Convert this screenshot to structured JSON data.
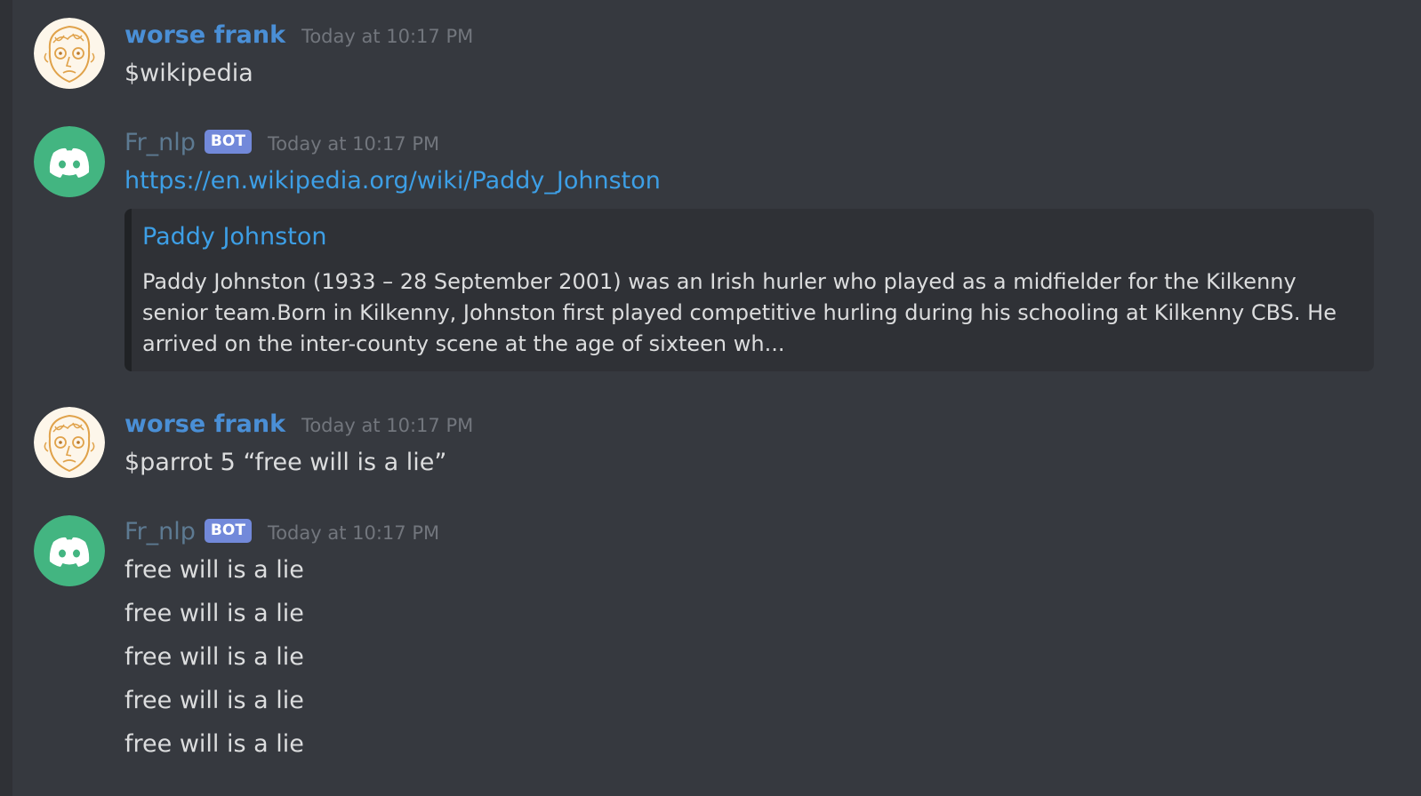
{
  "messages": [
    {
      "username": "worse frank",
      "timestamp": "Today at 10:17 PM",
      "text": "$wikipedia",
      "avatar_icon": "sketch-face-avatar-icon"
    },
    {
      "username": "Fr_nlp",
      "bot_tag": "BOT",
      "timestamp": "Today at 10:17 PM",
      "link": "https://en.wikipedia.org/wiki/Paddy_Johnston",
      "avatar_icon": "discord-logo-avatar-icon",
      "embed": {
        "title": "Paddy Johnston",
        "description": "Paddy Johnston (1933 – 28 September 2001) was an Irish hurler who played as a midfielder for the Kilkenny senior team.Born in Kilkenny, Johnston first played competitive hurling during his schooling at Kilkenny CBS. He arrived on the inter-county scene at the age of sixteen wh..."
      }
    },
    {
      "username": "worse frank",
      "timestamp": "Today at 10:17 PM",
      "text": "$parrot 5 “free will is a lie”",
      "avatar_icon": "sketch-face-avatar-icon"
    },
    {
      "username": "Fr_nlp",
      "bot_tag": "BOT",
      "timestamp": "Today at 10:17 PM",
      "avatar_icon": "discord-logo-avatar-icon",
      "lines": [
        "free will is a lie",
        "free will is a lie",
        "free will is a lie",
        "free will is a lie",
        "free will is a lie"
      ]
    }
  ],
  "colors": {
    "background": "#36393f",
    "username": "#4a8fd6",
    "bot_username": "#5d7a92",
    "bot_tag": "#7289da",
    "link": "#3d9fe6",
    "bot_avatar": "#43b581"
  }
}
